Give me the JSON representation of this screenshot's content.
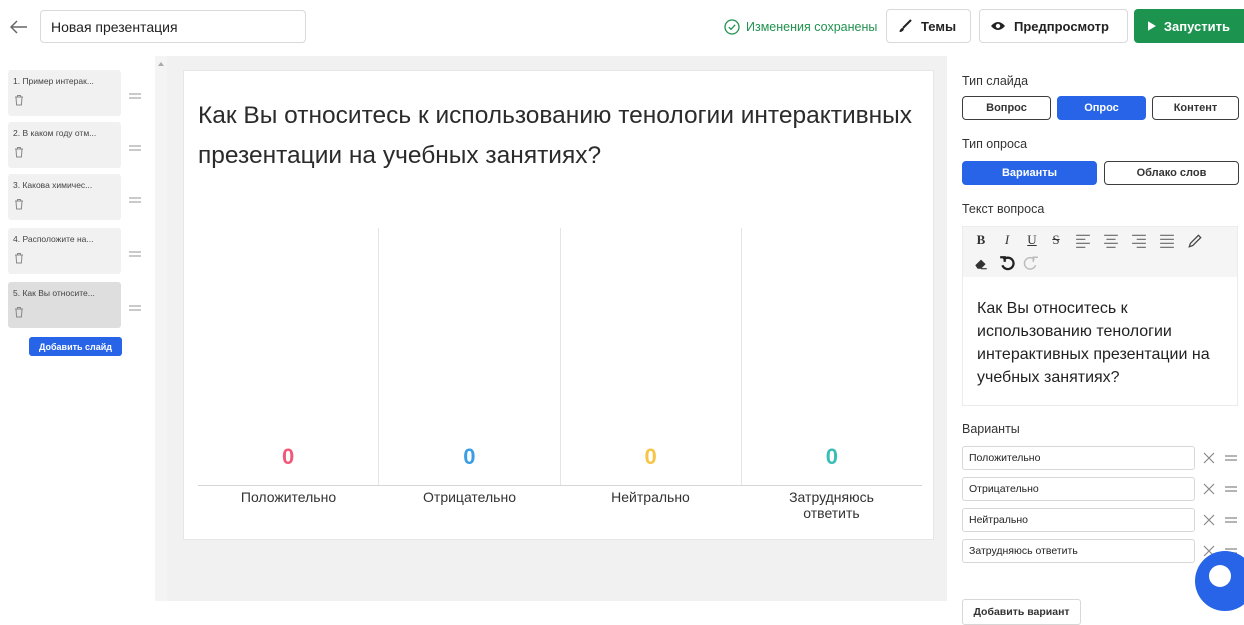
{
  "header": {
    "title_value": "Новая презентация",
    "saved_text": "Изменения сохранены",
    "themes_label": "Темы",
    "preview_label": "Предпросмотр",
    "run_label": "Запустить"
  },
  "sidebar": {
    "slides": [
      {
        "label": "1. Пример интерак..."
      },
      {
        "label": "2. В каком году отм..."
      },
      {
        "label": "3. Какова химичес..."
      },
      {
        "label": "4. Расположите на..."
      },
      {
        "label": "5. Как Вы относите..."
      }
    ],
    "add_slide_label": "Добавить слайд"
  },
  "slide": {
    "question": "Как Вы относитесь к использованию тенологии интерактивных презентации на учебных занятиях?"
  },
  "chart_data": {
    "type": "bar",
    "categories": [
      "Положительно",
      "Отрицательно",
      "Нейтрально",
      "Затрудняюсь ответить"
    ],
    "values": [
      0,
      0,
      0,
      0
    ],
    "colors": [
      "#f05a78",
      "#3a9ee4",
      "#f7c545",
      "#3bbdb8"
    ]
  },
  "panel": {
    "slide_type_label": "Тип слайда",
    "slide_types": [
      "Вопрос",
      "Опрос",
      "Контент"
    ],
    "poll_type_label": "Тип опроса",
    "poll_types": [
      "Варианты",
      "Облако слов"
    ],
    "question_text_label": "Текст вопроса",
    "question_text": "Как Вы относитесь к использованию тенологии интерактивных презентации на учебных занятиях?",
    "options_label": "Варианты",
    "options": [
      "Положительно",
      "Отрицательно",
      "Нейтрально",
      "Затрудняюсь ответить"
    ],
    "add_option_label": "Добавить вариант"
  }
}
